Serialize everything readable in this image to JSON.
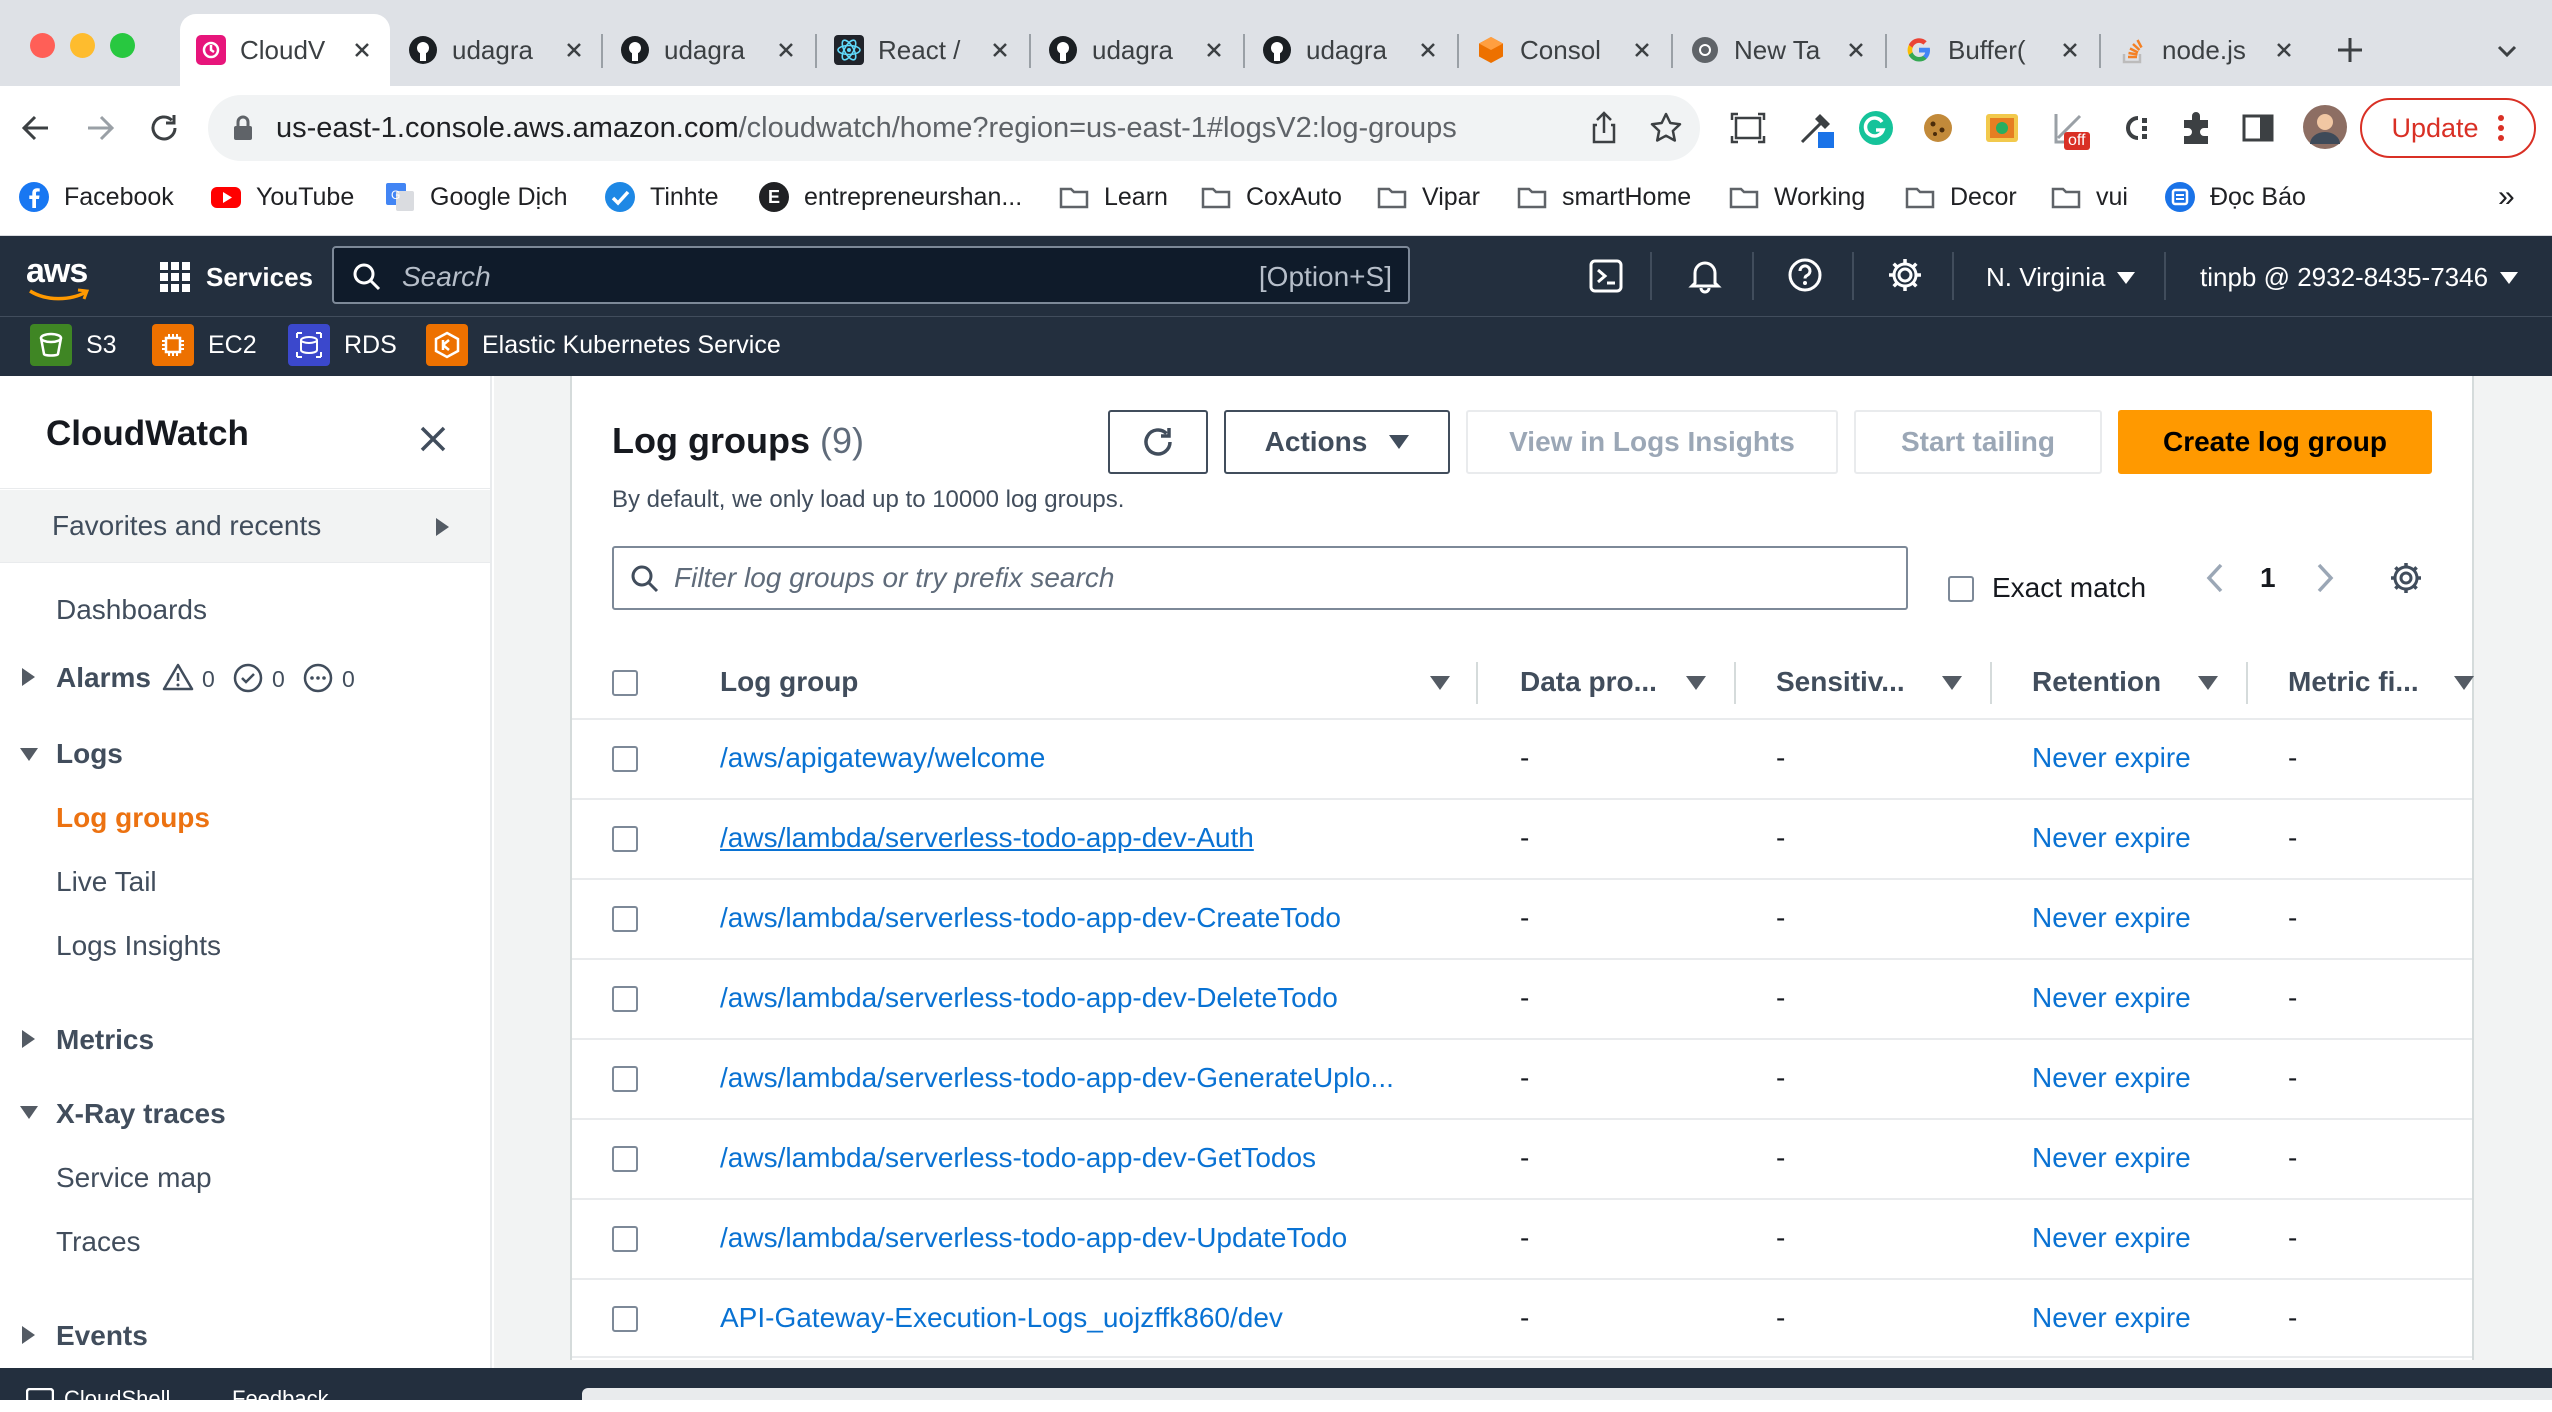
{
  "browser": {
    "tabs": [
      {
        "title": "CloudV",
        "icon": "cloudwatch-icon",
        "active": true
      },
      {
        "title": "udagra",
        "icon": "github-icon"
      },
      {
        "title": "udagra",
        "icon": "github-icon"
      },
      {
        "title": "React /",
        "icon": "react-icon"
      },
      {
        "title": "udagra",
        "icon": "github-icon"
      },
      {
        "title": "udagra",
        "icon": "github-icon"
      },
      {
        "title": "Consol",
        "icon": "aws-console-icon"
      },
      {
        "title": "New Ta",
        "icon": "chrome-icon"
      },
      {
        "title": "Buffer(",
        "icon": "google-icon"
      },
      {
        "title": "node.js",
        "icon": "stackoverflow-icon"
      }
    ],
    "url_host": "us-east-1.console.aws.amazon.com",
    "url_path": "/cloudwatch/home?region=us-east-1#logsV2:log-groups",
    "update_label": "Update",
    "extension_badge": "off",
    "bookmarks": [
      {
        "label": "Facebook",
        "icon": "facebook-icon"
      },
      {
        "label": "YouTube",
        "icon": "youtube-icon"
      },
      {
        "label": "Google Dịch",
        "icon": "google-translate-icon"
      },
      {
        "label": "Tinhte",
        "icon": "tinhte-icon"
      },
      {
        "label": "entrepreneurshan...",
        "icon": "e-circle-icon"
      },
      {
        "label": "Learn",
        "icon": "folder-icon"
      },
      {
        "label": "CoxAuto",
        "icon": "folder-icon"
      },
      {
        "label": "Vipar",
        "icon": "folder-icon"
      },
      {
        "label": "smartHome",
        "icon": "folder-icon"
      },
      {
        "label": "Working",
        "icon": "folder-icon"
      },
      {
        "label": "Decor",
        "icon": "folder-icon"
      },
      {
        "label": "vui",
        "icon": "folder-icon"
      },
      {
        "label": "Đọc Báo",
        "icon": "doc-bao-icon"
      }
    ],
    "bookmarks_more": "»"
  },
  "aws": {
    "logo": "aws",
    "services_label": "Services",
    "search_placeholder": "Search",
    "search_shortcut": "[Option+S]",
    "region": "N. Virginia",
    "account": "tinpb @ 2932-8435-7346",
    "favorites": [
      {
        "label": "S3",
        "color": "#3f8624"
      },
      {
        "label": "EC2",
        "color": "#ed7100"
      },
      {
        "label": "RDS",
        "color": "#3b48cc"
      },
      {
        "label": "Elastic Kubernetes Service",
        "color": "#ed7100"
      }
    ]
  },
  "sidebar": {
    "title": "CloudWatch",
    "favorites_label": "Favorites and recents",
    "dashboards": "Dashboards",
    "alarms": {
      "label": "Alarms",
      "alarm_count": "0",
      "ok_count": "0",
      "insufficient_count": "0"
    },
    "logs": {
      "label": "Logs",
      "items": [
        "Log groups",
        "Live Tail",
        "Logs Insights"
      ]
    },
    "metrics": "Metrics",
    "xray": {
      "label": "X-Ray traces",
      "items": [
        "Service map",
        "Traces"
      ]
    },
    "events": "Events"
  },
  "main": {
    "title": "Log groups",
    "count": "(9)",
    "description": "By default, we only load up to 10000 log groups.",
    "buttons": {
      "actions": "Actions",
      "view_insights": "View in Logs Insights",
      "start_tailing": "Start tailing",
      "create": "Create log group"
    },
    "filter_placeholder": "Filter log groups or try prefix search",
    "exact_match": "Exact match",
    "page": "1",
    "columns": [
      "Log group",
      "Data pro...",
      "Sensitiv...",
      "Retention",
      "Metric fi..."
    ],
    "rows": [
      {
        "name": "/aws/apigateway/welcome",
        "data_protection": "-",
        "sensitive": "-",
        "retention": "Never expire",
        "metric_filters": "-"
      },
      {
        "name": "/aws/lambda/serverless-todo-app-dev-Auth",
        "data_protection": "-",
        "sensitive": "-",
        "retention": "Never expire",
        "metric_filters": "-"
      },
      {
        "name": "/aws/lambda/serverless-todo-app-dev-CreateTodo",
        "data_protection": "-",
        "sensitive": "-",
        "retention": "Never expire",
        "metric_filters": "-"
      },
      {
        "name": "/aws/lambda/serverless-todo-app-dev-DeleteTodo",
        "data_protection": "-",
        "sensitive": "-",
        "retention": "Never expire",
        "metric_filters": "-"
      },
      {
        "name": "/aws/lambda/serverless-todo-app-dev-GenerateUplo...",
        "data_protection": "-",
        "sensitive": "-",
        "retention": "Never expire",
        "metric_filters": "-"
      },
      {
        "name": "/aws/lambda/serverless-todo-app-dev-GetTodos",
        "data_protection": "-",
        "sensitive": "-",
        "retention": "Never expire",
        "metric_filters": "-"
      },
      {
        "name": "/aws/lambda/serverless-todo-app-dev-UpdateTodo",
        "data_protection": "-",
        "sensitive": "-",
        "retention": "Never expire",
        "metric_filters": "-"
      },
      {
        "name": "API-Gateway-Execution-Logs_uojzffk860/dev",
        "data_protection": "-",
        "sensitive": "-",
        "retention": "Never expire",
        "metric_filters": "-"
      }
    ]
  },
  "footer": {
    "cloudshell": "CloudShell",
    "feedback": "Feedback"
  },
  "colors": {
    "aws_nav": "#232f3e",
    "primary": "#ff9900",
    "link": "#0972d3",
    "active_nav": "#ec7211"
  }
}
